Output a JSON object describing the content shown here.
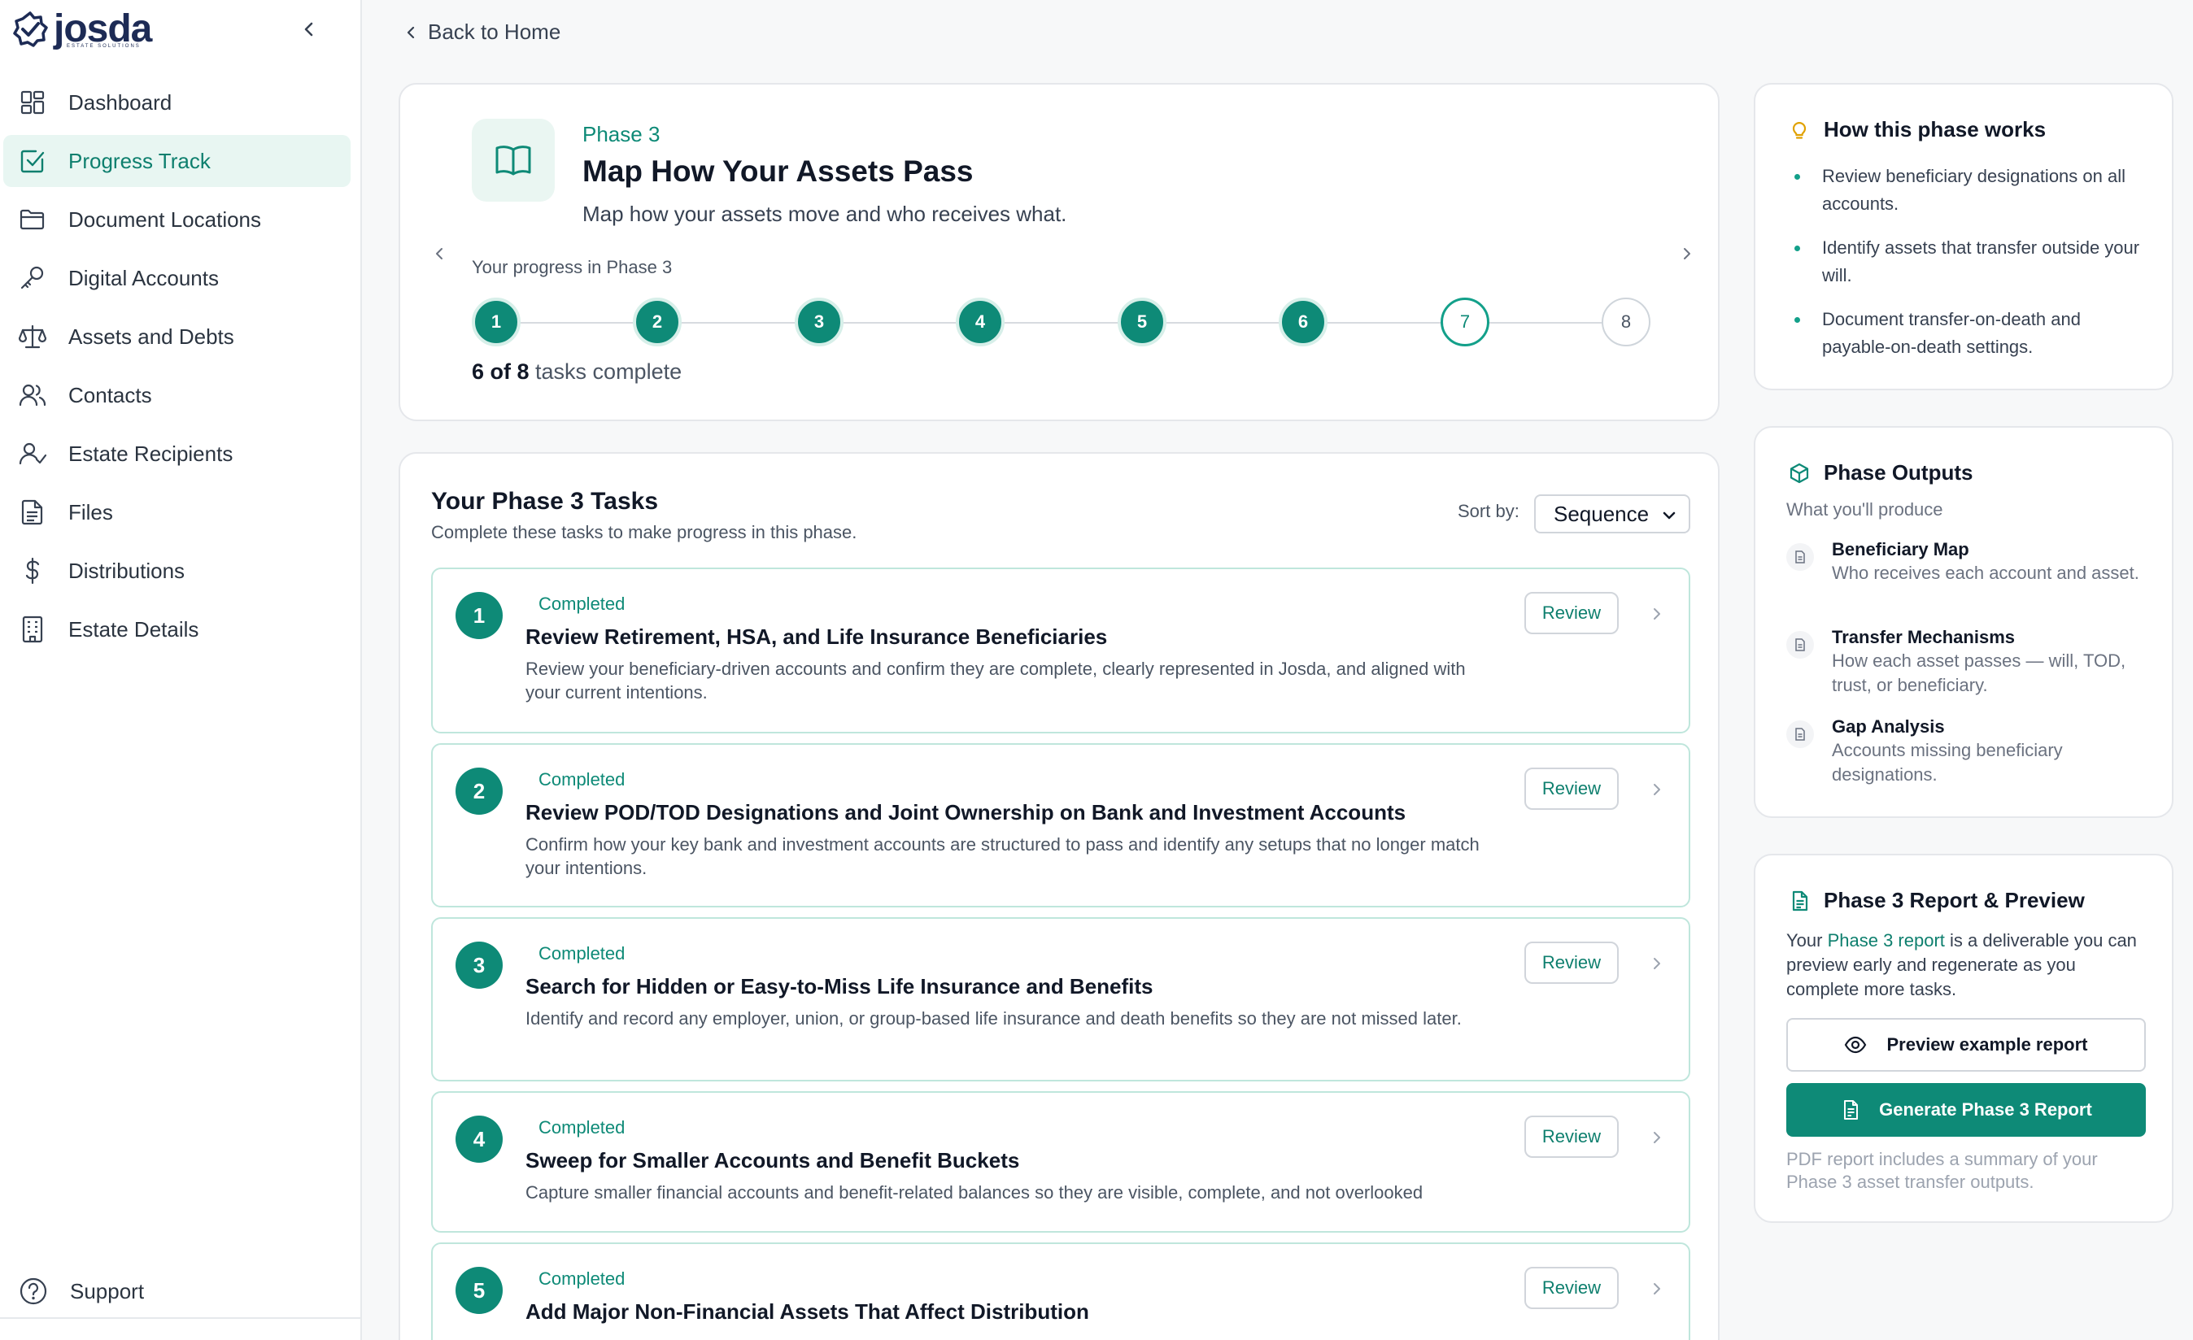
{
  "brand": {
    "name": "josda",
    "tagline": "ESTATE SOLUTIONS"
  },
  "sidebar": {
    "items": [
      {
        "label": "Dashboard",
        "icon": "dashboard-grid-icon",
        "active": false
      },
      {
        "label": "Progress Track",
        "icon": "checkbox-icon",
        "active": true
      },
      {
        "label": "Document Locations",
        "icon": "folder-icon",
        "active": false
      },
      {
        "label": "Digital Accounts",
        "icon": "key-icon",
        "active": false
      },
      {
        "label": "Assets and Debts",
        "icon": "scale-icon",
        "active": false
      },
      {
        "label": "Contacts",
        "icon": "users-icon",
        "active": false
      },
      {
        "label": "Estate Recipients",
        "icon": "user-check-icon",
        "active": false
      },
      {
        "label": "Files",
        "icon": "file-icon",
        "active": false
      },
      {
        "label": "Distributions",
        "icon": "dollar-icon",
        "active": false
      },
      {
        "label": "Estate Details",
        "icon": "building-icon",
        "active": false
      }
    ],
    "support_label": "Support"
  },
  "back_label": "Back to Home",
  "phase": {
    "eyebrow": "Phase 3",
    "title": "Map How Your Assets Pass",
    "subtitle": "Map how your assets move and who receives what.",
    "progress_label": "Your progress in Phase 3",
    "steps": [
      {
        "n": "1",
        "state": "done"
      },
      {
        "n": "2",
        "state": "done"
      },
      {
        "n": "3",
        "state": "done"
      },
      {
        "n": "4",
        "state": "done"
      },
      {
        "n": "5",
        "state": "done"
      },
      {
        "n": "6",
        "state": "done"
      },
      {
        "n": "7",
        "state": "current"
      },
      {
        "n": "8",
        "state": "todo"
      }
    ],
    "completed_count": "6 of 8",
    "completed_suffix": " tasks complete"
  },
  "tasks": {
    "title": "Your Phase 3 Tasks",
    "subtitle": "Complete these tasks to make progress in this phase.",
    "sort_label": "Sort by:",
    "sort_value": "Sequence",
    "review_label": "Review",
    "items": [
      {
        "n": "1",
        "status": "Completed",
        "title": "Review Retirement, HSA, and Life Insurance Beneficiaries",
        "desc": "Review your beneficiary-driven accounts and confirm they are complete, clearly represented in Josda, and aligned with your current intentions."
      },
      {
        "n": "2",
        "status": "Completed",
        "title": "Review POD/TOD Designations and Joint Ownership on Bank and Investment Accounts",
        "desc": "Confirm how your key bank and investment accounts are structured to pass and identify any setups that no longer match your intentions."
      },
      {
        "n": "3",
        "status": "Completed",
        "title": "Search for Hidden or Easy-to-Miss Life Insurance and Benefits",
        "desc": "Identify and record any employer, union, or group-based life insurance and death benefits so they are not missed later."
      },
      {
        "n": "4",
        "status": "Completed",
        "title": "Sweep for Smaller Accounts and Benefit Buckets",
        "desc": "Capture smaller financial accounts and benefit-related balances so they are visible, complete, and not overlooked"
      },
      {
        "n": "5",
        "status": "Completed",
        "title": "Add Major Non-Financial Assets That Affect Distribution",
        "desc": ""
      }
    ]
  },
  "how": {
    "title": "How this phase works",
    "bullets": [
      "Review beneficiary designations on all accounts.",
      "Identify assets that transfer outside your will.",
      "Document transfer-on-death and payable-on-death settings."
    ]
  },
  "outputs": {
    "title": "Phase Outputs",
    "subtitle": "What you'll produce",
    "items": [
      {
        "title": "Beneficiary Map",
        "desc": "Who receives each account and asset."
      },
      {
        "title": "Transfer Mechanisms",
        "desc": "How each asset passes — will, TOD, trust, or beneficiary."
      },
      {
        "title": "Gap Analysis",
        "desc": "Accounts missing beneficiary designations."
      }
    ]
  },
  "report": {
    "title": "Phase 3 Report & Preview",
    "text_before": "Your ",
    "text_link": "Phase 3 report",
    "text_after": " is a deliverable you can preview early and regenerate as you complete more tasks.",
    "preview_label": "Preview example report",
    "generate_label": "Generate Phase 3 Report",
    "note": "PDF report includes a summary of your Phase 3 asset transfer outputs."
  },
  "colors": {
    "accent": "#0e8a77",
    "accent_light": "#e8f6f2",
    "border": "#e5e7eb"
  }
}
